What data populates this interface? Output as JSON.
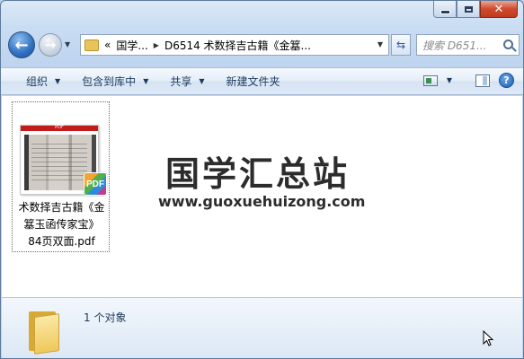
{
  "window": {
    "caption_buttons": [
      "minimize",
      "maximize",
      "close"
    ],
    "close_glyph": "✕"
  },
  "navigation": {
    "back_glyph": "←",
    "forward_glyph": "→",
    "address_overflow": "«",
    "address_segments": [
      "国学...",
      "D6514 术数择吉古籍《金簊..."
    ],
    "refresh_glyph": "⇆",
    "search_placeholder": "搜索 D651..."
  },
  "toolbar": {
    "items": [
      {
        "label": "组织",
        "has_dropdown": true
      },
      {
        "label": "包含到库中",
        "has_dropdown": true
      },
      {
        "label": "共享",
        "has_dropdown": true
      },
      {
        "label": "新建文件夹",
        "has_dropdown": false
      }
    ],
    "help_glyph": "?"
  },
  "files": [
    {
      "thumb_header": "PDF",
      "badge": "PDF",
      "name_lines": [
        "术数择吉古籍《金",
        "簊玉函传家宝》",
        "84页双面.pdf"
      ]
    }
  ],
  "watermark": {
    "title": "国学汇总站",
    "url": "www.guoxuehuizong.com"
  },
  "details": {
    "item_count": "1 个对象"
  },
  "colors": {
    "toolbar_text": "#1e395b",
    "close_button": "#c0391d",
    "pdf_header": "#c21b1b"
  }
}
